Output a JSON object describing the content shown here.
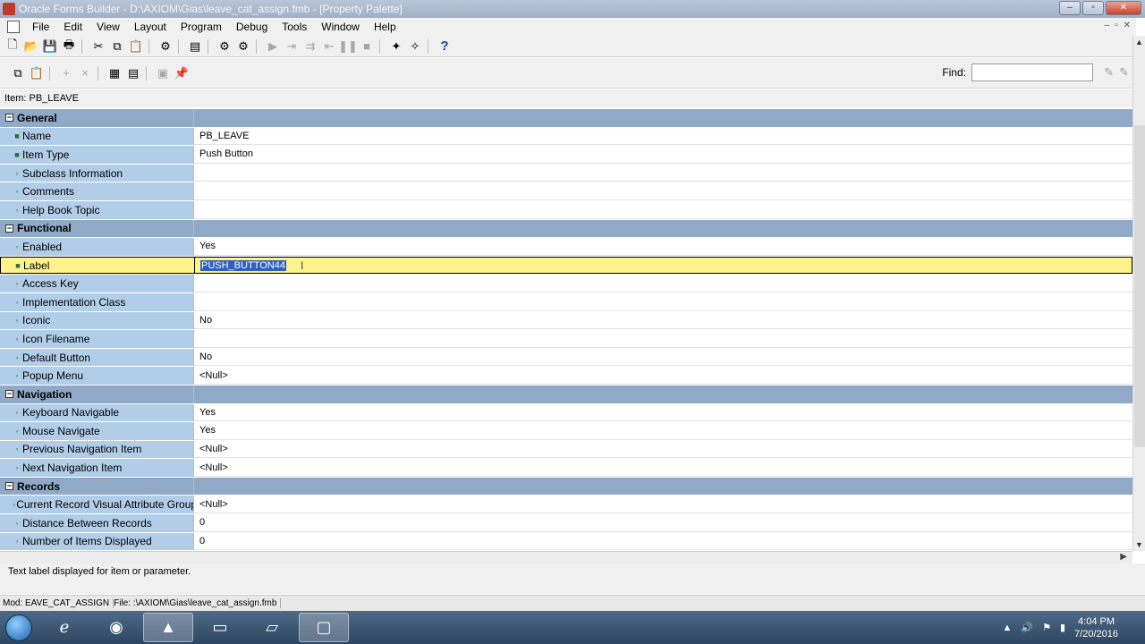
{
  "window": {
    "title": "Oracle Forms Builder - D:\\AXIOM\\Gias\\leave_cat_assign.fmb - [Property Palette]",
    "min_glyph": "–",
    "max_glyph": "▫",
    "close_glyph": "✕"
  },
  "menubar": {
    "items": [
      "File",
      "Edit",
      "View",
      "Layout",
      "Program",
      "Debug",
      "Tools",
      "Window",
      "Help"
    ],
    "mdi": [
      "–",
      "▫",
      "✕"
    ]
  },
  "palette": {
    "find_label": "Find:",
    "find_value": "",
    "item_label": "Item: PB_LEAVE"
  },
  "grid": {
    "rows": [
      {
        "type": "category",
        "toggle": "−",
        "name": "General",
        "value": ""
      },
      {
        "type": "prop",
        "marker": "■",
        "name": "Name",
        "value": "PB_LEAVE"
      },
      {
        "type": "prop",
        "marker": "■",
        "name": "Item Type",
        "value": "Push Button"
      },
      {
        "type": "prop",
        "marker": "◦",
        "name": "Subclass Information",
        "value": ""
      },
      {
        "type": "prop",
        "marker": "◦",
        "name": "Comments",
        "value": ""
      },
      {
        "type": "prop",
        "marker": "◦",
        "name": "Help Book Topic",
        "value": ""
      },
      {
        "type": "category",
        "toggle": "−",
        "name": "Functional",
        "value": ""
      },
      {
        "type": "prop",
        "marker": "◦",
        "name": "Enabled",
        "value": "Yes"
      },
      {
        "type": "selected",
        "marker": "■",
        "name": "Label",
        "value": "PUSH_BUTTON44"
      },
      {
        "type": "prop",
        "marker": "◦",
        "name": "Access Key",
        "value": ""
      },
      {
        "type": "prop",
        "marker": "◦",
        "name": "Implementation Class",
        "value": ""
      },
      {
        "type": "prop",
        "marker": "◦",
        "name": "Iconic",
        "value": "No"
      },
      {
        "type": "prop",
        "marker": "◦",
        "name": "Icon Filename",
        "value": ""
      },
      {
        "type": "prop",
        "marker": "◦",
        "name": "Default Button",
        "value": "No"
      },
      {
        "type": "prop",
        "marker": "◦",
        "name": "Popup Menu",
        "value": "<Null>"
      },
      {
        "type": "category",
        "toggle": "−",
        "name": "Navigation",
        "value": ""
      },
      {
        "type": "prop",
        "marker": "◦",
        "name": "Keyboard Navigable",
        "value": "Yes"
      },
      {
        "type": "prop",
        "marker": "◦",
        "name": "Mouse Navigate",
        "value": "Yes"
      },
      {
        "type": "prop",
        "marker": "◦",
        "name": "Previous Navigation Item",
        "value": "<Null>"
      },
      {
        "type": "prop",
        "marker": "◦",
        "name": "Next Navigation Item",
        "value": "<Null>"
      },
      {
        "type": "category",
        "toggle": "−",
        "name": "Records",
        "value": ""
      },
      {
        "type": "prop",
        "marker": "◦",
        "name": "Current Record Visual Attribute Group",
        "value": "<Null>"
      },
      {
        "type": "prop",
        "marker": "◦",
        "name": "Distance Between Records",
        "value": "0"
      },
      {
        "type": "prop",
        "marker": "◦",
        "name": "Number of Items Displayed",
        "value": "0"
      }
    ]
  },
  "description": "Text label displayed for item or parameter.",
  "status": {
    "module": "Mod: EAVE_CAT_ASSIGN",
    "file": "File: :\\AXIOM\\Gias\\leave_cat_assign.fmb"
  },
  "taskbar": {
    "time": "4:04 PM",
    "date": "7/20/2016"
  }
}
